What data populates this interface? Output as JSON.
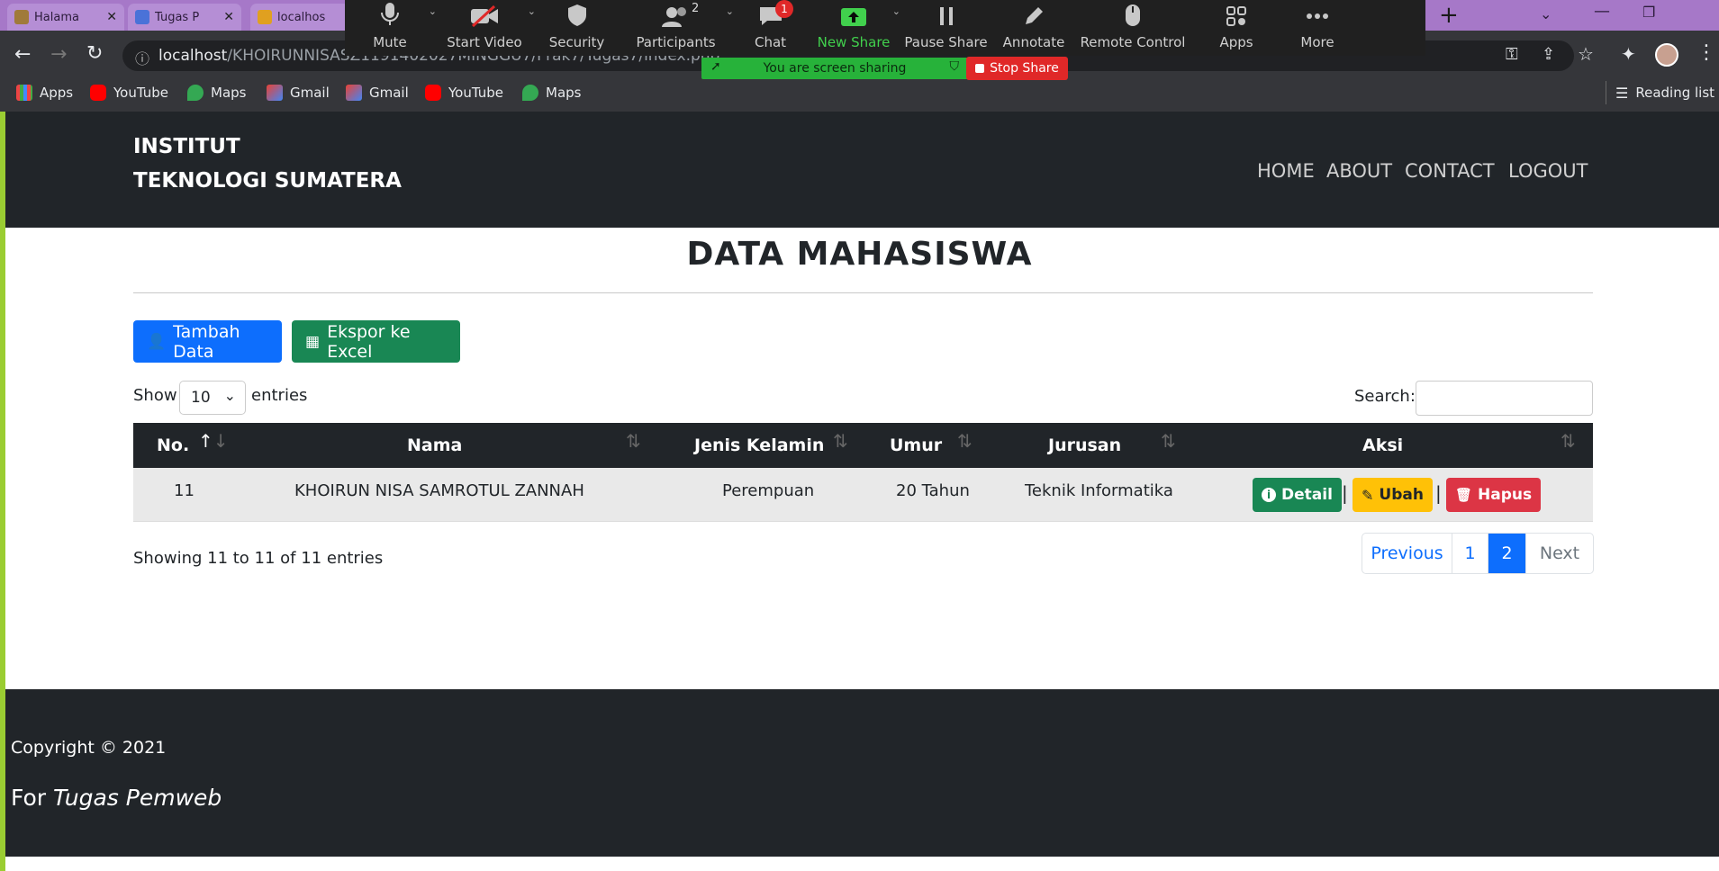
{
  "browser": {
    "tabs": [
      {
        "label": "Halama",
        "color": "#a07a3a"
      },
      {
        "label": "Tugas P",
        "color": "#4a72d8"
      },
      {
        "label": "localhos",
        "color": "#e0a020"
      }
    ],
    "url_host": "localhost",
    "url_path": "/KHOIRUNNISASZ1191402027MINGGU7/Prak7/Tugas7/index.php",
    "bookmarks": [
      {
        "label": "Apps",
        "icon": "apps-grid-icon"
      },
      {
        "label": "YouTube",
        "icon": "youtube-icon"
      },
      {
        "label": "Maps",
        "icon": "maps-icon"
      },
      {
        "label": "Gmail",
        "icon": "gmail-icon"
      },
      {
        "label": "Gmail",
        "icon": "gmail-icon"
      },
      {
        "label": "YouTube",
        "icon": "youtube-icon"
      },
      {
        "label": "Maps",
        "icon": "maps-icon"
      }
    ],
    "reading_list": "Reading list"
  },
  "zoom": {
    "buttons": [
      {
        "label": "Mute",
        "icon": "microphone-icon"
      },
      {
        "label": "Start Video",
        "icon": "video-off-icon"
      },
      {
        "label": "Security",
        "icon": "shield-icon"
      },
      {
        "label": "Participants",
        "icon": "participants-icon",
        "count": "2"
      },
      {
        "label": "Chat",
        "icon": "chat-icon",
        "badge": "1"
      },
      {
        "label": "New Share",
        "icon": "share-screen-icon"
      },
      {
        "label": "Pause Share",
        "icon": "pause-icon"
      },
      {
        "label": "Annotate",
        "icon": "pencil-icon"
      },
      {
        "label": "Remote Control",
        "icon": "mouse-icon"
      },
      {
        "label": "Apps",
        "icon": "apps-icon"
      },
      {
        "label": "More",
        "icon": "more-icon"
      }
    ],
    "sharing_text": "You are screen sharing",
    "stop_share": "Stop Share"
  },
  "site": {
    "brand_line1": "INSTITUT",
    "brand_line2": "TEKNOLOGI SUMATERA",
    "nav": [
      "HOME",
      "ABOUT",
      "CONTACT",
      "LOGOUT"
    ],
    "page_title": "DATA MAHASISWA",
    "btn_add": "Tambah Data",
    "btn_export": "Ekspor ke Excel",
    "show_label": "Show",
    "entries_value": "10",
    "entries_label": "entries",
    "search_label": "Search:",
    "columns": [
      "No.",
      "Nama",
      "Jenis Kelamin",
      "Umur",
      "Jurusan",
      "Aksi"
    ],
    "rows": [
      {
        "no": "11",
        "nama": "KHOIRUN NISA SAMROTUL ZANNAH",
        "jk": "Perempuan",
        "umur": "20 Tahun",
        "jurusan": "Teknik Informatika"
      }
    ],
    "actions": {
      "detail": "Detail",
      "ubah": "Ubah",
      "hapus": "Hapus"
    },
    "info": "Showing 11 to 11 of 11 entries",
    "pagination": [
      "Previous",
      "1",
      "2",
      "Next"
    ],
    "footer_line1": "Copyright © 2021",
    "footer_for": "For",
    "footer_em": "Tugas Pemweb",
    "colors": {
      "primary": "#0d6efd",
      "success": "#198754",
      "warning": "#ffc107",
      "danger": "#dc3545",
      "dark": "#212529"
    }
  }
}
